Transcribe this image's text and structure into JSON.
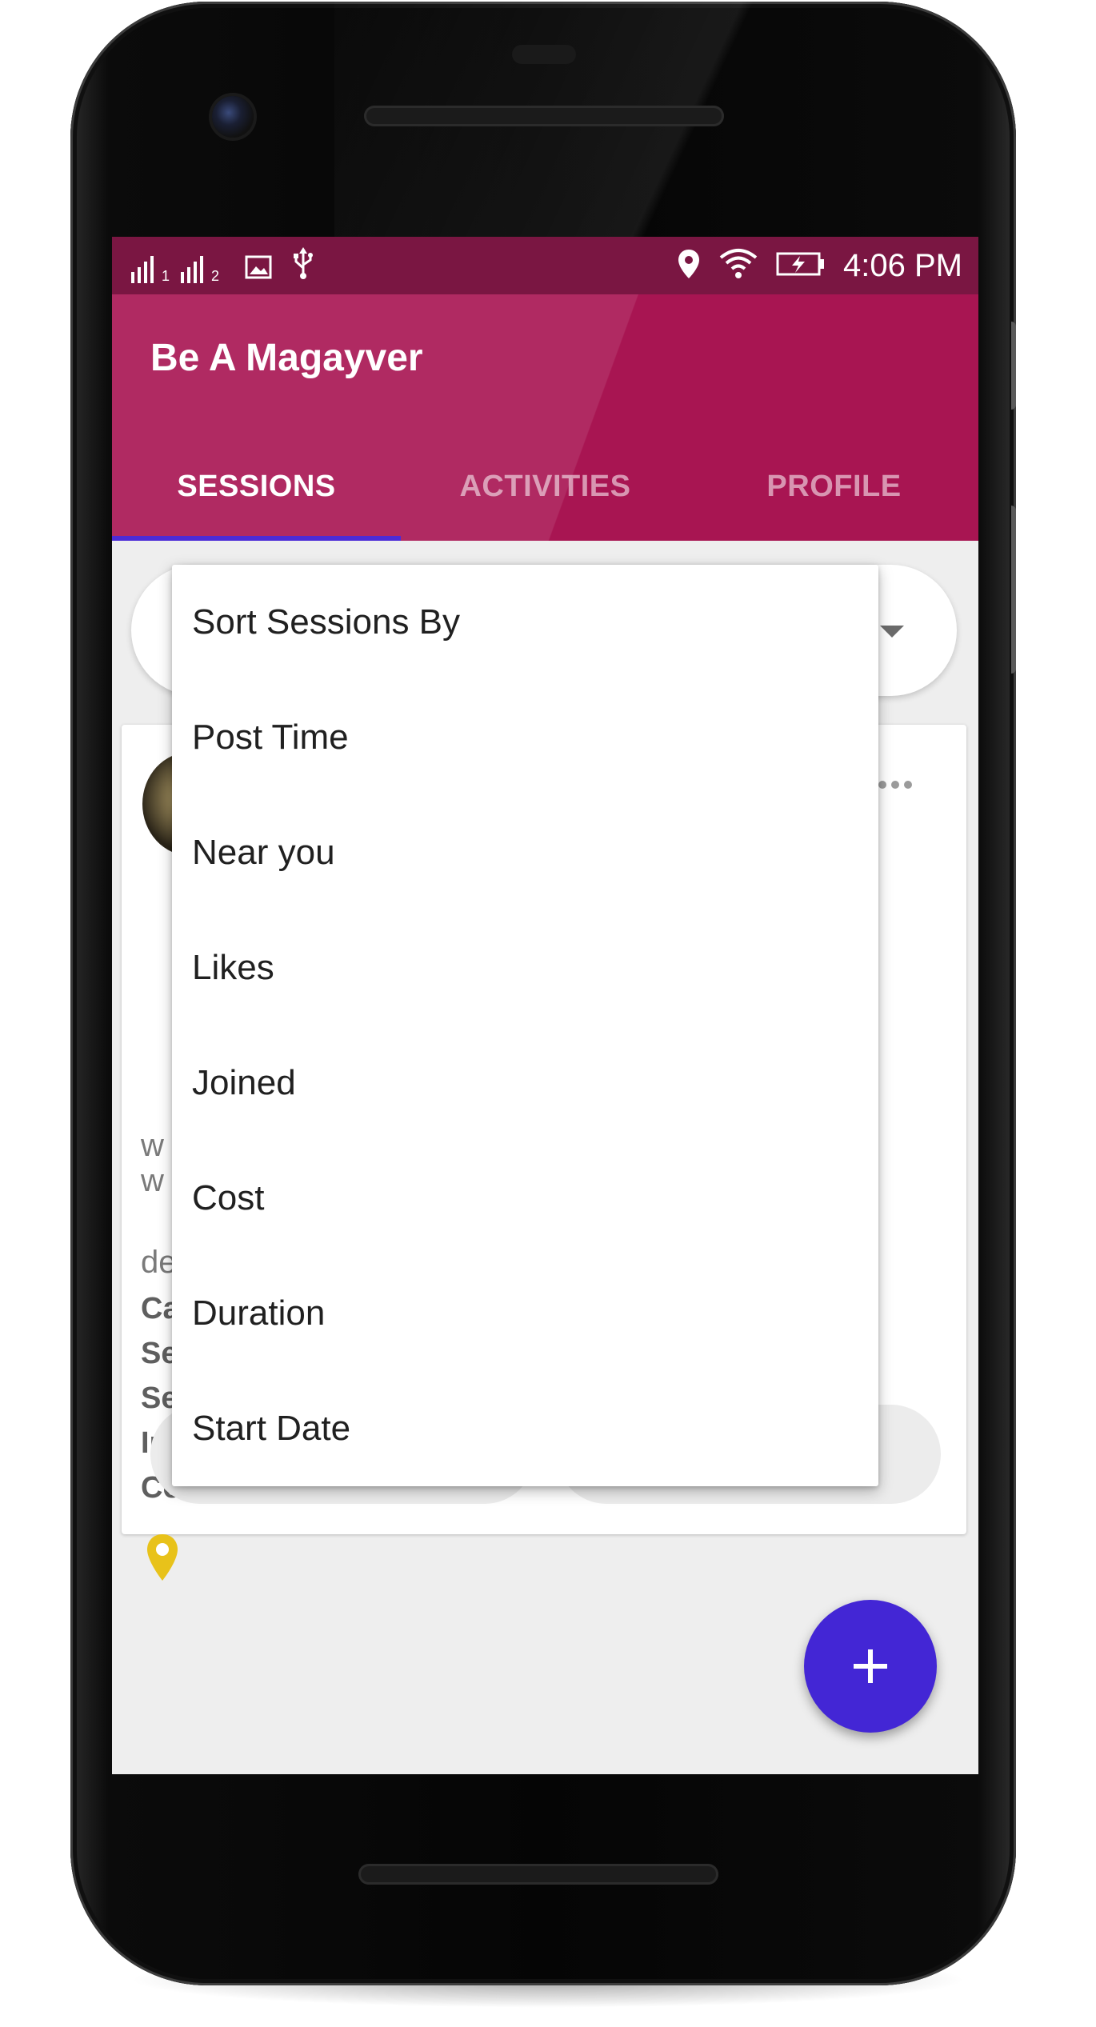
{
  "status_bar": {
    "sim1_label": "1",
    "sim2_label": "2",
    "time": "4:06 PM",
    "icons": [
      "signal-icon",
      "signal-icon",
      "image-icon",
      "usb-icon",
      "location-icon",
      "wifi-icon",
      "battery-charging-icon"
    ]
  },
  "app": {
    "title": "Be A Magayver",
    "brand_color": "#a81552",
    "status_bar_color": "#7a1642",
    "accent_color": "#4326d5"
  },
  "tabs": [
    {
      "label": "SESSIONS",
      "active": true
    },
    {
      "label": "ACTIVITIES",
      "active": false
    },
    {
      "label": "PROFILE",
      "active": false
    }
  ],
  "sort_menu": {
    "header": "Sort Sessions By",
    "items": [
      "Post Time",
      "Near you",
      "Likes",
      "Joined",
      "Cost",
      "Duration",
      "Start Date"
    ]
  },
  "card_peek": {
    "line1": "w",
    "line2": "w",
    "line3": "de",
    "bold1": "Ca",
    "bold2": "Se",
    "bold3": "Se",
    "bold4": "In",
    "bold5": "Co"
  },
  "fab": {
    "icon": "plus-icon",
    "label": "+"
  }
}
